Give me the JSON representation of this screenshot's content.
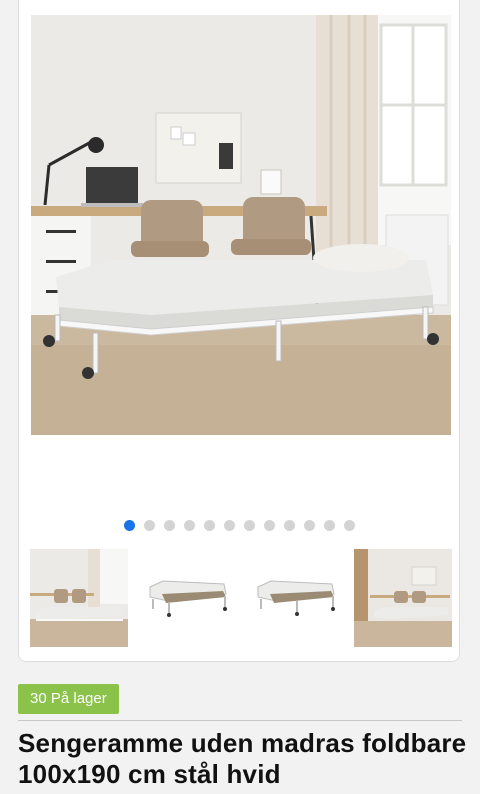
{
  "gallery": {
    "main_image": "bedroom-photo-bed-frame-white",
    "dot_count": 12,
    "active_dot": 1,
    "thumbnails": [
      {
        "image": "bedroom-photo-thumbnail",
        "selected": true
      },
      {
        "image": "bed-frame-cutout-front"
      },
      {
        "image": "bed-frame-cutout-side"
      },
      {
        "image": "bedroom-photo-wide"
      }
    ]
  },
  "stock": {
    "label": "30 På lager",
    "color": "#8bc34a"
  },
  "product": {
    "title": "Sengeramme uden madras foldbare 100x190 cm stål hvid"
  },
  "colors": {
    "accent": "#1a73e8"
  }
}
